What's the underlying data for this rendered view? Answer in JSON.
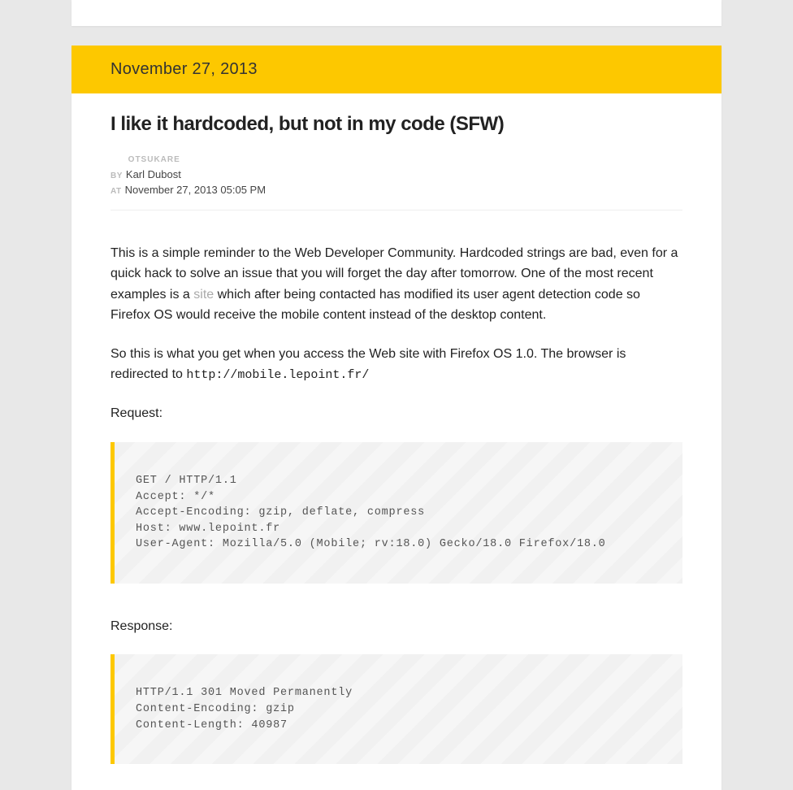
{
  "banner_date": "November 27, 2013",
  "title": "I like it hardcoded, but not in my code (SFW)",
  "meta": {
    "site_label": "OTSUKARE",
    "by_label": "BY",
    "author": "Karl Dubost",
    "at_label": "AT",
    "timestamp": "November 27, 2013 05:05 PM"
  },
  "para1_a": "This is a simple reminder to the Web Developer Community. Hardcoded strings are bad, even for a quick hack to solve an issue that you will forget the day after tomorrow. One of the most recent examples is a ",
  "site_link": "site",
  "para1_b": " which after being contacted has modified its user agent detection code so Firefox OS would receive the mobile content instead of the desktop content.",
  "para2_a": "So this is what you get when you access the Web site with Firefox OS 1.0. The browser is redirected to ",
  "redirect_url": "http://mobile.lepoint.fr/",
  "request_label": "Request:",
  "code_request": "GET / HTTP/1.1\nAccept: */*\nAccept-Encoding: gzip, deflate, compress\nHost: www.lepoint.fr\nUser-Agent: Mozilla/5.0 (Mobile; rv:18.0) Gecko/18.0 Firefox/18.0",
  "response_label": "Response:",
  "code_response": "HTTP/1.1 301 Moved Permanently\nContent-Encoding: gzip\nContent-Length: 40987"
}
